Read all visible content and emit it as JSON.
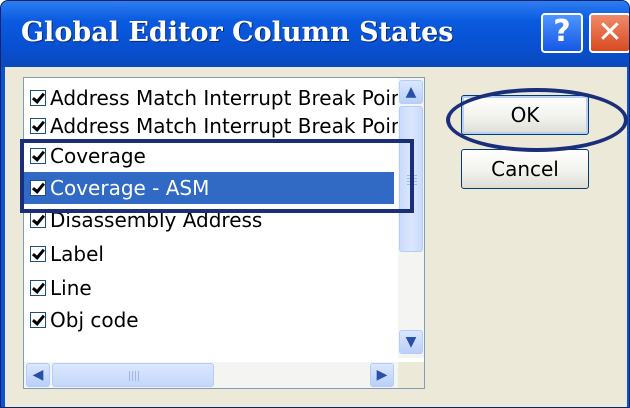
{
  "dialog": {
    "title": "Global Editor Column States",
    "help_glyph": "?",
    "close_glyph": "✕"
  },
  "columns": [
    {
      "label": "Address Match Interrupt Break Points",
      "checked": true
    },
    {
      "label": "Address Match Interrupt Break Points",
      "checked": true
    },
    {
      "label": "Coverage",
      "checked": true
    },
    {
      "label": "Coverage - ASM",
      "checked": true
    },
    {
      "label": "Disassembly Address",
      "checked": true
    },
    {
      "label": "Label",
      "checked": true
    },
    {
      "label": "Line",
      "checked": true
    },
    {
      "label": "Obj code",
      "checked": true
    }
  ],
  "selected_column": "Coverage - ASM",
  "buttons": {
    "ok": "OK",
    "cancel": "Cancel"
  },
  "scrollbar": {
    "up": "▲",
    "down": "▼",
    "left": "◀",
    "right": "▶"
  },
  "colors": {
    "titlebar": "#0a5ae0",
    "selection": "#316ac5",
    "annotation": "#1a2e7a"
  }
}
